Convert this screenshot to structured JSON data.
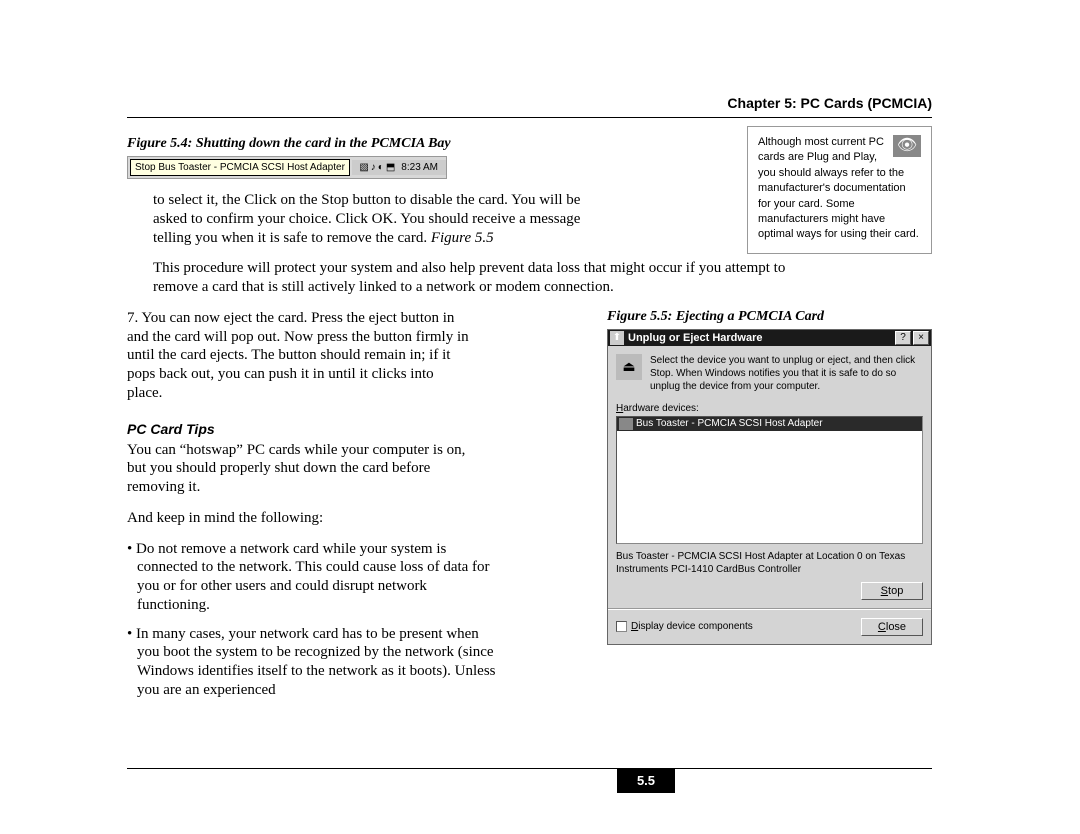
{
  "chapter_header": "Chapter 5: PC Cards (PCMCIA)",
  "fig54_caption": "Figure 5.4: Shutting down the card in the PCMCIA Bay",
  "systray": {
    "tooltip": "Stop Bus Toaster - PCMCIA SCSI Host Adapter",
    "time": "8:23 AM"
  },
  "tip_box": "Although most current PC cards are Plug and Play, you should always refer to the manufacturer's documentation for your card. Some manufacturers might have optimal ways for using their card.",
  "para1_a": "to select it, the Click on the Stop button to disable the card. You will be asked to confirm your choice. Click OK. You should receive a message telling you when it is safe to remove the card. ",
  "para1_figref": "Figure 5.5",
  "para2": "This procedure will protect your system and also help prevent data loss that might occur if you attempt to remove a card that is still actively linked to a network or modem connection.",
  "item7_num": "7.",
  "item7": "You can now eject the card. Press the eject button in and the card will pop out. Now press the button firmly in until the card ejects. The button should remain in; if it pops back out, you can push it in until it clicks into place.",
  "section_heading": "PC Card Tips",
  "tips_para1": "You can “hotswap” PC cards while your computer is on, but you should properly shut down the card before removing it.",
  "tips_para2": "And keep in mind the following:",
  "bullet1": "• Do not remove a network card while your system is connected to the network. This could cause loss of data for you or for other users and could disrupt network functioning.",
  "bullet2": "• In many cases, your network card has to be present when you boot the system to be recognized by the network (since Windows identifies itself to the network as it boots). Unless you are an experienced",
  "fig55_caption": "Figure 5.5: Ejecting a PCMCIA Card",
  "dialog": {
    "title": "Unplug or Eject Hardware",
    "help_btn": "?",
    "close_btn": "×",
    "instruction": "Select the device you want to unplug or eject, and then click Stop. When Windows notifies you that it is safe to do so unplug the device from your computer.",
    "hw_label_pre": "H",
    "hw_label_rest": "ardware devices:",
    "selected_item": "Bus Toaster - PCMCIA SCSI Host Adapter",
    "status": "Bus Toaster - PCMCIA SCSI Host Adapter at Location 0 on Texas Instruments PCI-1410 CardBus Controller",
    "stop_btn_pre": "S",
    "stop_btn_rest": "top",
    "checkbox_pre": "D",
    "checkbox_rest": "isplay device components",
    "close2_pre": "C",
    "close2_rest": "lose"
  },
  "page_number": "5.5"
}
